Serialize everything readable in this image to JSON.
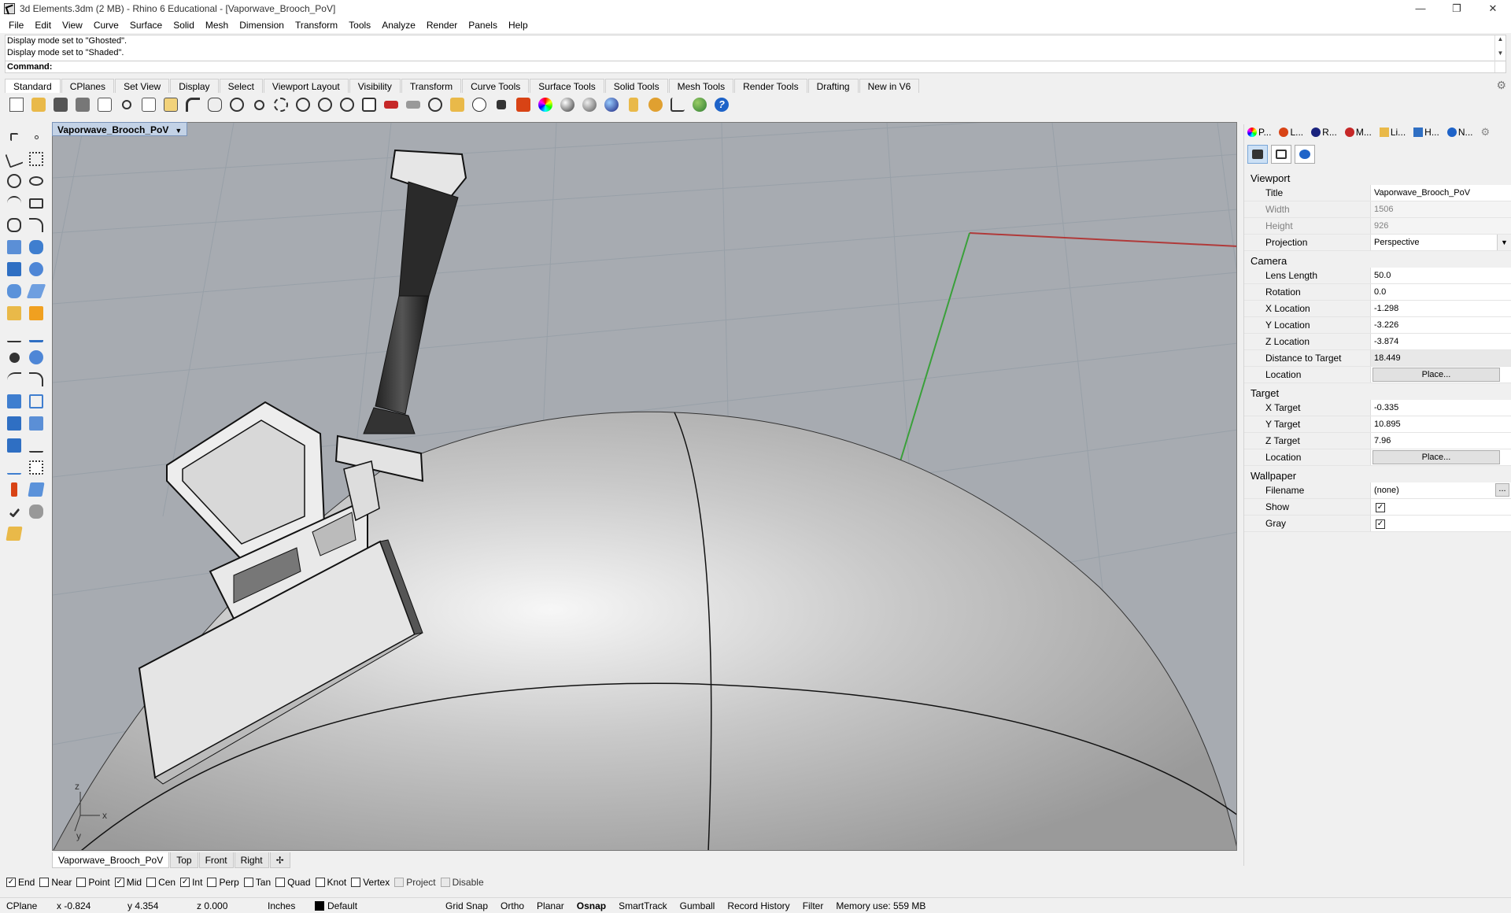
{
  "window": {
    "title": "3d Elements.3dm (2 MB) - Rhino 6 Educational - [Vaporwave_Brooch_PoV]",
    "minimize": "—",
    "restore": "❐",
    "close": "✕"
  },
  "menu": [
    "File",
    "Edit",
    "View",
    "Curve",
    "Surface",
    "Solid",
    "Mesh",
    "Dimension",
    "Transform",
    "Tools",
    "Analyze",
    "Render",
    "Panels",
    "Help"
  ],
  "command": {
    "history": [
      "Display mode set to \"Ghosted\".",
      "Display mode set to \"Shaded\"."
    ],
    "prompt": "Command:"
  },
  "toolbar_tabs": [
    "Standard",
    "CPlanes",
    "Set View",
    "Display",
    "Select",
    "Viewport Layout",
    "Visibility",
    "Transform",
    "Curve Tools",
    "Surface Tools",
    "Solid Tools",
    "Mesh Tools",
    "Render Tools",
    "Drafting",
    "New in V6"
  ],
  "viewport": {
    "title": "Vaporwave_Brooch_PoV",
    "tabs": [
      "Vaporwave_Brooch_PoV",
      "Top",
      "Front",
      "Right"
    ]
  },
  "panel": {
    "tabs": [
      "P...",
      "L...",
      "R...",
      "M...",
      "Li...",
      "H...",
      "N..."
    ],
    "viewport_section": "Viewport",
    "camera_section": "Camera",
    "target_section": "Target",
    "wallpaper_section": "Wallpaper",
    "viewport_props": {
      "title_label": "Title",
      "title_value": "Vaporwave_Brooch_PoV",
      "width_label": "Width",
      "width_value": "1506",
      "height_label": "Height",
      "height_value": "926",
      "projection_label": "Projection",
      "projection_value": "Perspective"
    },
    "camera_props": {
      "lens_label": "Lens Length",
      "lens_value": "50.0",
      "rotation_label": "Rotation",
      "rotation_value": "0.0",
      "xloc_label": "X Location",
      "xloc_value": "-1.298",
      "yloc_label": "Y Location",
      "yloc_value": "-3.226",
      "zloc_label": "Z Location",
      "zloc_value": "-3.874",
      "dist_label": "Distance to Target",
      "dist_value": "18.449",
      "location_label": "Location",
      "place_button": "Place..."
    },
    "target_props": {
      "xt_label": "X Target",
      "xt_value": "-0.335",
      "yt_label": "Y Target",
      "yt_value": "10.895",
      "zt_label": "Z Target",
      "zt_value": "7.96",
      "location_label": "Location",
      "place_button": "Place..."
    },
    "wallpaper_props": {
      "filename_label": "Filename",
      "filename_value": "(none)",
      "browse": "...",
      "show_label": "Show",
      "show_check": "✓",
      "gray_label": "Gray",
      "gray_check": "✓"
    }
  },
  "osnap": [
    {
      "label": "End",
      "checked": "✓"
    },
    {
      "label": "Near",
      "checked": ""
    },
    {
      "label": "Point",
      "checked": ""
    },
    {
      "label": "Mid",
      "checked": "✓"
    },
    {
      "label": "Cen",
      "checked": ""
    },
    {
      "label": "Int",
      "checked": "✓"
    },
    {
      "label": "Perp",
      "checked": ""
    },
    {
      "label": "Tan",
      "checked": ""
    },
    {
      "label": "Quad",
      "checked": ""
    },
    {
      "label": "Knot",
      "checked": ""
    },
    {
      "label": "Vertex",
      "checked": ""
    },
    {
      "label": "Project",
      "checked": ""
    },
    {
      "label": "Disable",
      "checked": ""
    }
  ],
  "status": {
    "cplane": "CPlane",
    "x": "x -0.824",
    "y": "y 4.354",
    "z": "z 0.000",
    "units": "Inches",
    "layer": "Default",
    "grid_snap": "Grid Snap",
    "ortho": "Ortho",
    "planar": "Planar",
    "osnap": "Osnap",
    "smarttrack": "SmartTrack",
    "gumball": "Gumball",
    "record_history": "Record History",
    "filter": "Filter",
    "memory": "Memory use: 559 MB"
  },
  "axis_labels": {
    "z": "z",
    "y": "y",
    "x": "x"
  },
  "colors": {
    "accent": "#0078d7",
    "viewport_bg": "#a7abb1",
    "x_axis": "#b03a3a",
    "y_axis": "#3aa03a"
  }
}
